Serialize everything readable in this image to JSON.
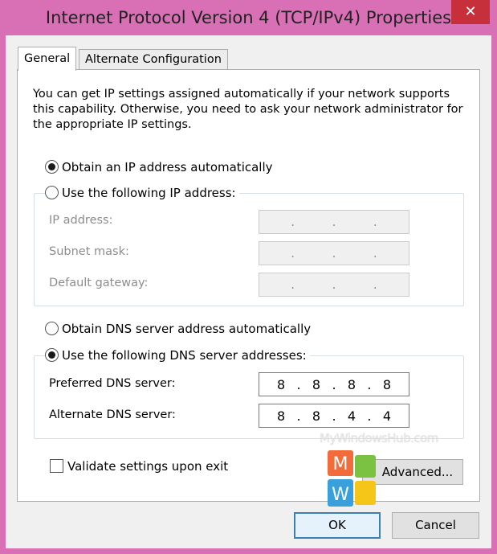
{
  "window": {
    "title": "Internet Protocol Version 4 (TCP/IPv4) Properties",
    "close_glyph": "✕"
  },
  "tabs": [
    {
      "label": "General",
      "active": true
    },
    {
      "label": "Alternate Configuration",
      "active": false
    }
  ],
  "intro_text": "You can get IP settings assigned automatically if your network supports this capability. Otherwise, you need to ask your network administrator for the appropriate IP settings.",
  "ip_mode": {
    "auto_label": "Obtain an IP address automatically",
    "auto_selected": true,
    "manual_label": "Use the following IP address:",
    "manual_selected": false,
    "fields": [
      {
        "label": "IP address:",
        "value": [
          ".",
          ".",
          "."
        ]
      },
      {
        "label": "Subnet mask:",
        "value": [
          ".",
          ".",
          "."
        ]
      },
      {
        "label": "Default gateway:",
        "value": [
          ".",
          ".",
          "."
        ]
      }
    ]
  },
  "dns_mode": {
    "auto_label": "Obtain DNS server address automatically",
    "auto_selected": false,
    "manual_label": "Use the following DNS server addresses:",
    "manual_selected": true,
    "preferred": {
      "label": "Preferred DNS server:",
      "octets": [
        "8",
        ".",
        "8",
        ".",
        "8",
        ".",
        "8"
      ]
    },
    "alternate": {
      "label": "Alternate DNS server:",
      "octets": [
        "8",
        ".",
        "8",
        ".",
        "4",
        ".",
        "4"
      ]
    }
  },
  "validate": {
    "label": "Validate settings upon exit",
    "checked": false
  },
  "buttons": {
    "advanced": "Advanced...",
    "ok": "OK",
    "cancel": "Cancel"
  },
  "watermark": {
    "text": "MyWindowsHub.com",
    "letters": [
      "M",
      "W"
    ],
    "colors": {
      "orange": "#f26b3a",
      "green": "#7cc242",
      "blue": "#3aa0dc",
      "yellow": "#f5c518"
    }
  },
  "colors": {
    "frame": "#d96fb4",
    "close": "#c7303a",
    "accent": "#3c7fb1"
  }
}
